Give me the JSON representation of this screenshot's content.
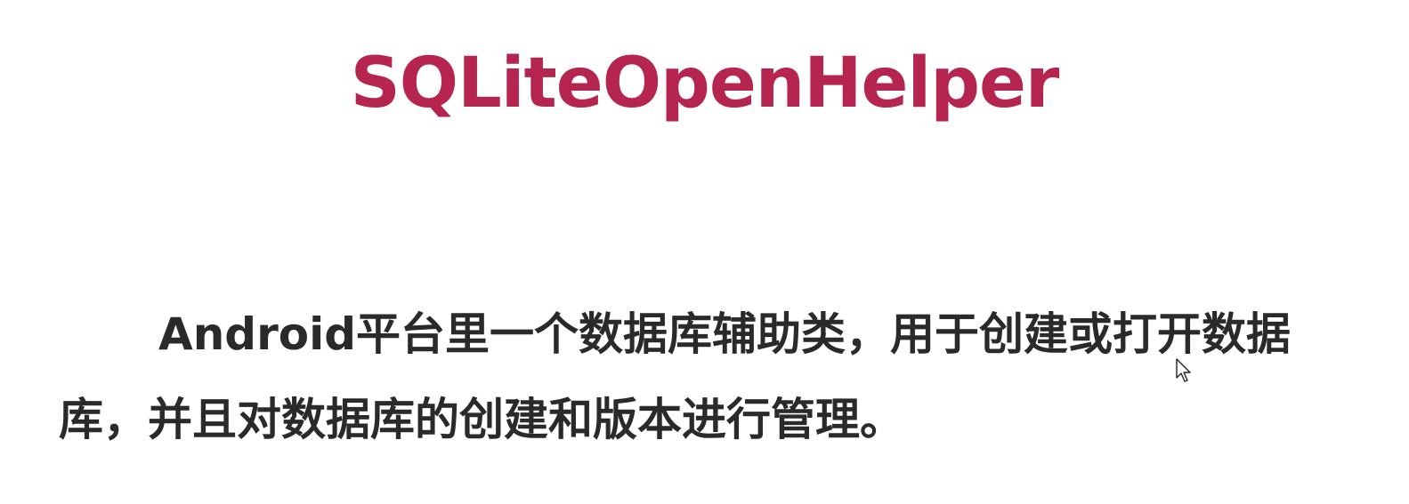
{
  "slide": {
    "title": "SQLiteOpenHelper",
    "body": "Android平台里一个数据库辅助类，用于创建或打开数据库，并且对数据库的创建和版本进行管理。"
  },
  "colors": {
    "title": "#b5254f",
    "body_text": "#2a2a2a",
    "background": "#ffffff"
  },
  "icons": {
    "pointer": "mouse-pointer-icon"
  }
}
